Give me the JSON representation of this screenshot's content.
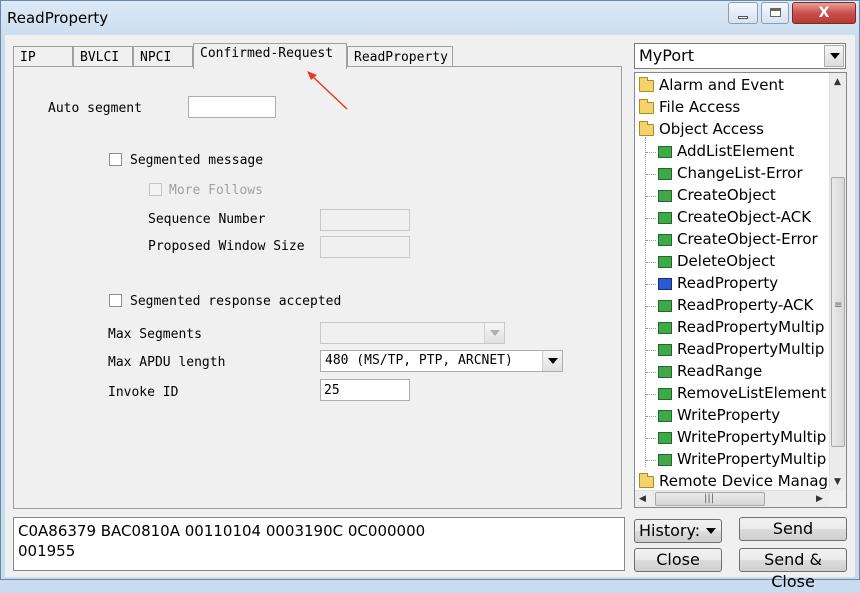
{
  "window": {
    "title": "ReadProperty",
    "controls": {
      "minimize": "min",
      "maximize": "max",
      "close": "X"
    }
  },
  "tabs": [
    {
      "label": "IP"
    },
    {
      "label": "BVLCI"
    },
    {
      "label": "NPCI"
    },
    {
      "label": "Confirmed-Request",
      "active": true
    },
    {
      "label": "ReadProperty"
    }
  ],
  "form": {
    "auto_segment_label": "Auto segment",
    "auto_segment_value": "",
    "segmented_message_label": "Segmented message",
    "segmented_message_checked": false,
    "more_follows_label": "More Follows",
    "more_follows_checked": false,
    "sequence_number_label": "Sequence Number",
    "sequence_number_value": "",
    "proposed_window_label": "Proposed Window Size",
    "proposed_window_value": "",
    "segmented_response_label": "Segmented response accepted",
    "segmented_response_checked": false,
    "max_segments_label": "Max Segments",
    "max_segments_value": "",
    "max_apdu_label": "Max APDU length",
    "max_apdu_value": "480 (MS/TP, PTP, ARCNET)",
    "invoke_id_label": "Invoke ID",
    "invoke_id_value": "25"
  },
  "port": {
    "selected": "MyPort"
  },
  "tree": {
    "folders": [
      {
        "label": "Alarm and Event"
      },
      {
        "label": "File Access"
      },
      {
        "label": "Object Access"
      }
    ],
    "children": [
      {
        "label": "AddListElement"
      },
      {
        "label": "ChangeList-Error"
      },
      {
        "label": "CreateObject"
      },
      {
        "label": "CreateObject-ACK"
      },
      {
        "label": "CreateObject-Error"
      },
      {
        "label": "DeleteObject"
      },
      {
        "label": "ReadProperty",
        "selected": true
      },
      {
        "label": "ReadProperty-ACK"
      },
      {
        "label": "ReadPropertyMultip"
      },
      {
        "label": "ReadPropertyMultip"
      },
      {
        "label": "ReadRange"
      },
      {
        "label": "RemoveListElement"
      },
      {
        "label": "WriteProperty"
      },
      {
        "label": "WritePropertyMultip"
      },
      {
        "label": "WritePropertyMultip"
      }
    ],
    "last_folder": {
      "label": "Remote Device Manage"
    }
  },
  "hex": {
    "line1": "C0A86379 BAC0810A 00110104 0003190C 0C000000",
    "line2": "001955"
  },
  "buttons": {
    "history": "History:",
    "send": "Send",
    "close": "Close",
    "send_close": "Send & Close"
  },
  "colors": {
    "annotation_arrow": "#e53a2a",
    "selected_icon": "#2c5bd0",
    "leaf_icon": "#3fa84a",
    "folder_icon": "#f3d36b"
  }
}
